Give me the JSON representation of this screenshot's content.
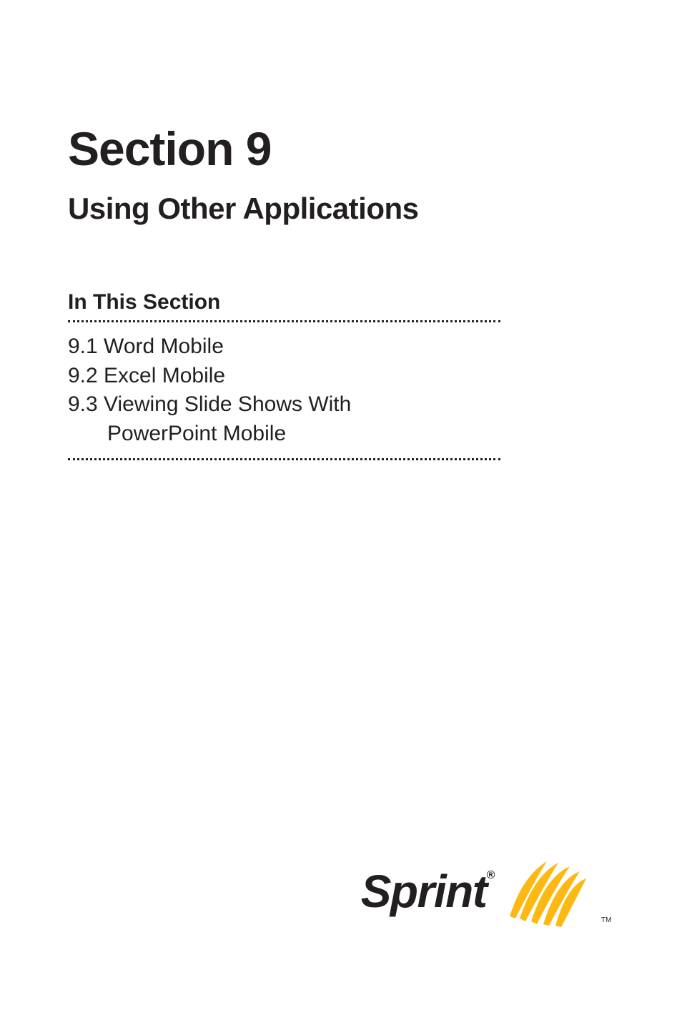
{
  "section": {
    "number": "Section 9",
    "title": "Using Other Applications"
  },
  "toc": {
    "header": "In This Section",
    "items": [
      "9.1  Word Mobile",
      "9.2  Excel Mobile",
      "9.3  Viewing Slide Shows With",
      "PowerPoint Mobile"
    ]
  },
  "logo": {
    "brand": "Sprint",
    "reg": "®",
    "tm": "TM"
  }
}
